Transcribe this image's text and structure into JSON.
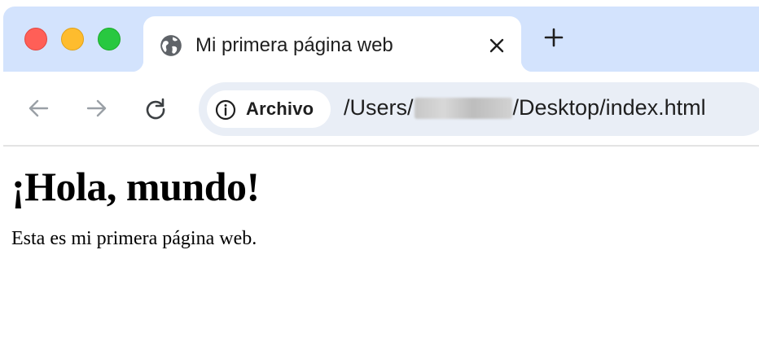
{
  "tab": {
    "title": "Mi primera página web",
    "close_icon": "close-icon",
    "favicon": "globe-icon"
  },
  "new_tab": {
    "icon": "plus-icon"
  },
  "window_controls": {
    "close_color": "#ff5f57",
    "minimize_color": "#febc2e",
    "maximize_color": "#28c840"
  },
  "toolbar": {
    "back_icon": "arrow-left-icon",
    "forward_icon": "arrow-right-icon",
    "reload_icon": "reload-icon"
  },
  "omnibox": {
    "chip_label": "Archivo",
    "chip_icon": "info-icon",
    "url_prefix": "/Users/",
    "url_suffix": "/Desktop/index.html"
  },
  "page": {
    "heading": "¡Hola, mundo!",
    "paragraph": "Esta es mi primera página web."
  },
  "colors": {
    "tabstrip": "#d3e3fd",
    "omnibox": "#e9eef6",
    "text": "#1f1f1f"
  }
}
